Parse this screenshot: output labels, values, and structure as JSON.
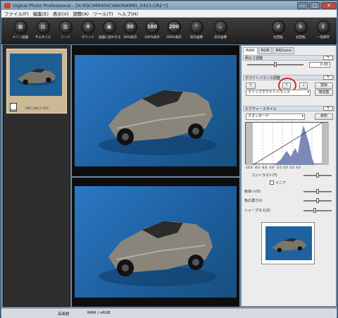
{
  "window": {
    "title": "Digital Photo Professional - [H:¥DCIM¥404CANON¥IMG_0423.CR2 *]",
    "minimize": "—",
    "maximize": "□",
    "close": "✕"
  },
  "menu": [
    "ファイル(F)",
    "編集(E)",
    "表示(V)",
    "調整(A)",
    "ツール(T)",
    "ヘルプ(H)"
  ],
  "toolbar": {
    "left": [
      {
        "label": "メイン画面",
        "glyph": "▦"
      },
      {
        "label": "サムネイル",
        "glyph": "▤"
      },
      {
        "label": "シート",
        "glyph": "▥"
      },
      {
        "label": "グリッド",
        "glyph": "#"
      },
      {
        "label": "画面に合わせる",
        "glyph": "▣"
      },
      {
        "label": "50%表示",
        "glyph": "50"
      },
      {
        "label": "100%表示",
        "glyph": "100"
      },
      {
        "label": "200%表示",
        "glyph": "200"
      },
      {
        "label": "前の画像",
        "glyph": "⌃"
      },
      {
        "label": "次の画像",
        "glyph": "⌄"
      }
    ],
    "right": [
      {
        "label": "左回転",
        "glyph": "↺"
      },
      {
        "label": "右回転",
        "glyph": "↻"
      },
      {
        "label": "一括保存",
        "glyph": "↧"
      }
    ]
  },
  "thumbnail": {
    "filename": "IMG_0423.CR2",
    "raw_badge": "RAW"
  },
  "panel": {
    "tabs": [
      "RAW",
      "RGB",
      "NR/Lens"
    ],
    "brightness_title": "明るさ調整",
    "brightness_value": "0.00",
    "reset": "↰",
    "wb_title": "ホワイトバランス調整",
    "wb_register": "登録",
    "wb_preset": "クリックホワイトバランス",
    "wb_fine": "微調整",
    "style_title": "ピクチャースタイル",
    "style_value": "スタンダード",
    "style_browse": "参照",
    "hist_labels": [
      "-10.0",
      "-8.0",
      "-6.0",
      "-4.0",
      "-2.0",
      "0.0",
      "2.0",
      "4.0"
    ],
    "contrast": "コントラスト(T)",
    "linear": "リニア",
    "hue": "色あい(O)",
    "saturation": "色の濃さ(I)",
    "sharpness": "シャープネス(Z)"
  },
  "status": {
    "quality": "高画質",
    "colorspace": "RAW / sRGB"
  }
}
